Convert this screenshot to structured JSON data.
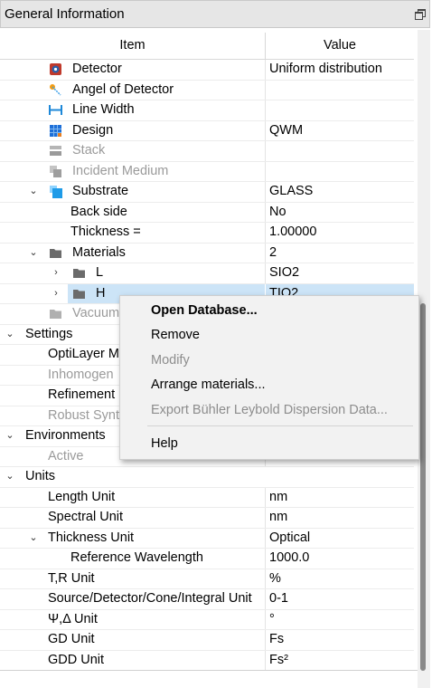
{
  "panel": {
    "title": "General Information"
  },
  "columns": {
    "item": "Item",
    "value": "Value"
  },
  "rows": {
    "detector": {
      "label": "Detector",
      "value": "Uniform distribution"
    },
    "angel": {
      "label": "Angel of Detector",
      "value": ""
    },
    "linewidth": {
      "label": "Line Width",
      "value": ""
    },
    "design": {
      "label": "Design",
      "value": "QWM"
    },
    "stack": {
      "label": "Stack",
      "value": ""
    },
    "incident": {
      "label": "Incident Medium",
      "value": ""
    },
    "substrate": {
      "label": "Substrate",
      "value": "GLASS"
    },
    "backside": {
      "label": "Back side",
      "value": "No"
    },
    "thickness": {
      "label": "Thickness =",
      "value": "1.00000"
    },
    "materials": {
      "label": "Materials",
      "value": "2"
    },
    "mat_l": {
      "label": "L",
      "value": "SIO2"
    },
    "mat_h": {
      "label": "H",
      "value": "TIO2"
    },
    "vacuum": {
      "label": "Vacuum"
    },
    "settings": {
      "label": "Settings"
    },
    "optilayer": {
      "label": "OptiLayer M"
    },
    "inhomogen": {
      "label": "Inhomogen"
    },
    "refinement": {
      "label": "Refinement"
    },
    "robust": {
      "label": "Robust Synt"
    },
    "environments": {
      "label": "Environments"
    },
    "active": {
      "label": "Active",
      "value": ""
    },
    "units": {
      "label": "Units"
    },
    "length": {
      "label": "Length Unit",
      "value": "nm"
    },
    "spectral": {
      "label": "Spectral Unit",
      "value": "nm"
    },
    "thickunit": {
      "label": "Thickness Unit",
      "value": "Optical"
    },
    "refwave": {
      "label": "Reference Wavelength",
      "value": "1000.0"
    },
    "tr": {
      "label": "T,R Unit",
      "value": "%"
    },
    "source": {
      "label": "Source/Detector/Cone/Integral Unit",
      "value": "0-1"
    },
    "psi": {
      "label": "Ψ,Δ Unit",
      "value": "°"
    },
    "gd": {
      "label": "GD Unit",
      "value": "Fs"
    },
    "gdd": {
      "label": "GDD Unit",
      "value": "Fs²"
    }
  },
  "context_menu": {
    "open_database": "Open Database...",
    "remove": "Remove",
    "modify": "Modify",
    "arrange": "Arrange materials...",
    "export": "Export Bühler Leybold Dispersion Data...",
    "help": "Help"
  },
  "colors": {
    "selection": "#cce4f7",
    "header_bg": "#e6e6e6",
    "folder": "#6b6b6b",
    "substrate_icon": "#1e9be8"
  }
}
